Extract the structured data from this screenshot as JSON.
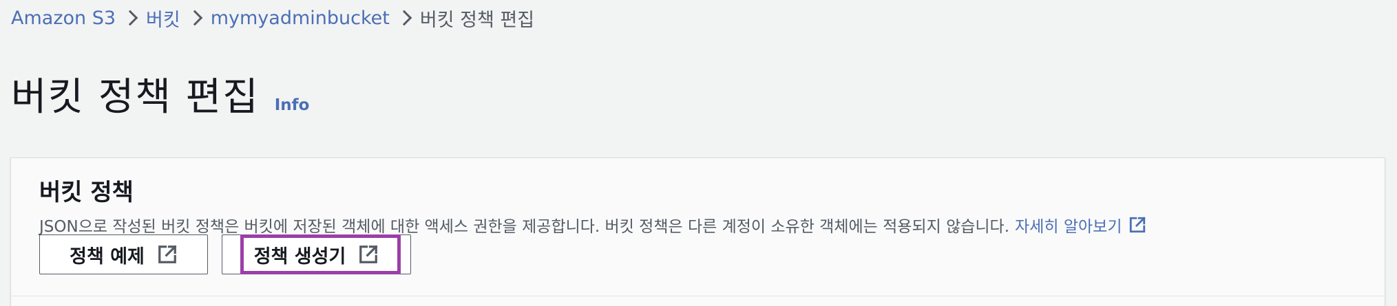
{
  "breadcrumb": {
    "items": [
      "Amazon S3",
      "버킷",
      "mymyadminbucket"
    ],
    "current": "버킷 정책 편집"
  },
  "header": {
    "title": "버킷 정책 편집",
    "info_link": "Info"
  },
  "panel": {
    "heading": "버킷 정책",
    "description": "JSON으로 작성된 버킷 정책은 버킷에 저장된 객체에 대한 액세스 권한을 제공합니다. 버킷 정책은 다른 계정이 소유한 객체에는 적용되지 않습니다.",
    "learn_more": "자세히 알아보기",
    "buttons": {
      "examples": "정책 예제",
      "generator": "정책 생성기"
    }
  },
  "colors": {
    "link": "#4b6fb5",
    "highlight": "#9b3fa8",
    "background": "#f2f3f3"
  },
  "icons": {
    "separator": "chevron-right-icon",
    "external": "external-link-icon"
  }
}
